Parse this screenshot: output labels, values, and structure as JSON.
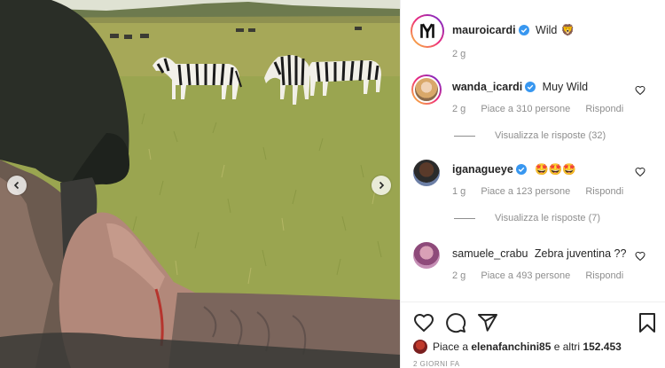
{
  "post": {
    "author": "mauroicardi",
    "caption": "Wild",
    "caption_emoji": "🦁",
    "age": "2 g"
  },
  "comments": [
    {
      "user": "wanda_icardi",
      "verified": true,
      "text": "Muy Wild",
      "age": "2 g",
      "likes": "Piace a 310 persone",
      "reply": "Rispondi",
      "view_replies": "Visualizza le risposte (32)"
    },
    {
      "user": "iganagueye",
      "verified": true,
      "text": "🤩🤩🤩",
      "age": "1 g",
      "likes": "Piace a 123 persone",
      "reply": "Rispondi",
      "view_replies": "Visualizza le risposte (7)"
    },
    {
      "user": "samuele_crabu",
      "verified": false,
      "text": "Zebra juventina ??",
      "age": "2 g",
      "likes": "Piace a 493 persone",
      "reply": "Rispondi"
    }
  ],
  "likes_bar": {
    "prefix": "Piace a ",
    "user": "elenafanchini85",
    "middle": " e altri ",
    "count": "152.453"
  },
  "footer_time": "2 GIORNI FA",
  "icons": [
    "verified-icon",
    "heart-icon",
    "comment-icon",
    "share-icon",
    "bookmark-icon",
    "chevron-left-icon",
    "chevron-right-icon"
  ],
  "colors": {
    "verified": "#3897f0",
    "muted": "#8e8e8e",
    "text": "#262626"
  }
}
